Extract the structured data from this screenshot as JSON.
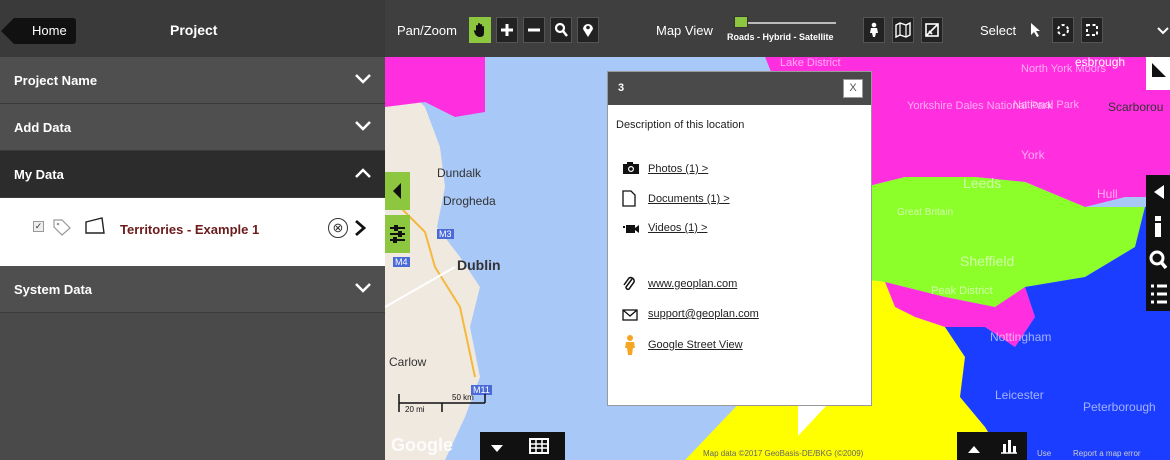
{
  "sidebar": {
    "home_label": "Home",
    "title": "Project",
    "sections": {
      "project_name": "Project Name",
      "add_data": "Add Data",
      "my_data": "My Data",
      "system_data": "System Data"
    },
    "layer": {
      "name": "Territories - Example 1",
      "remove_symbol": "⊗",
      "checked": true
    }
  },
  "toolbar": {
    "pan_zoom_label": "Pan/Zoom",
    "map_view_label": "Map View",
    "map_type_label": "Roads - Hybrid - Satellite",
    "select_label": "Select"
  },
  "map": {
    "place_labels": {
      "dundalk": "Dundalk",
      "drogheda": "Drogheda",
      "dublin": "Dublin",
      "carlow": "Carlow",
      "m3": "M3",
      "m4": "M4",
      "m11": "M11",
      "york": "York",
      "leeds": "Leeds",
      "hull": "Hull",
      "sheffield": "Sheffield",
      "nottingham": "Nottingham",
      "leicester": "Leicester",
      "peterborough": "Peterborough",
      "scarborough": "Scarborou",
      "middlesbrough": "esbrough",
      "great_britain": "Great Britain",
      "peak_district": "Peak District",
      "lake_district": "Lake District",
      "north_york_moors": "North York Moors",
      "yorkshire_dales": "Yorkshire Dales National Park",
      "national_park": "National Park"
    },
    "scale": {
      "km": "50 km",
      "mi": "20 mi"
    },
    "google": "Google",
    "attribution": "Map data ©2017 GeoBasis-DE/BKG (©2009)",
    "report": "Report a map error",
    "terms": "Use"
  },
  "popup": {
    "title": "3",
    "close_label": "X",
    "description": "Description of this location",
    "links": {
      "photos": "Photos (1) >",
      "documents": "Documents (1) >",
      "videos": "Videos (1) >",
      "website": "www.geoplan.com",
      "email": "support@geoplan.com",
      "street_view": "Google Street View"
    }
  },
  "colors": {
    "accent": "#8dc63f",
    "magenta": "#ff2fe0",
    "lime": "#8cff2a",
    "yellow": "#ffff00",
    "blue": "#1a3dff",
    "water": "#a8c8f8"
  }
}
